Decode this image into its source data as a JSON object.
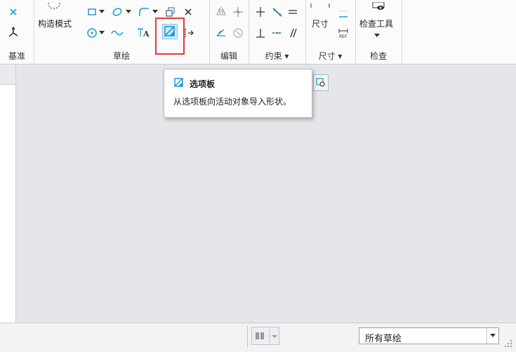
{
  "ribbon": {
    "groups": {
      "datum": "基准",
      "sketch": "草绘",
      "edit": "编辑",
      "constrain": "约束",
      "dimension": "尺寸",
      "inspect": "检查"
    },
    "construction_mode": "构造模式",
    "dimension_btn": "尺寸",
    "inspect_tools": "检查工具"
  },
  "tooltip": {
    "title": "选项板",
    "description": "从选项板向活动对象导入形状。"
  },
  "status": {
    "filter_value": "所有草绘"
  },
  "colors": {
    "accent": "#1a9ad6",
    "highlight_border": "#e53935",
    "ribbon_bg": "#fbfbfc",
    "canvas_bg": "#e4e6ea"
  }
}
